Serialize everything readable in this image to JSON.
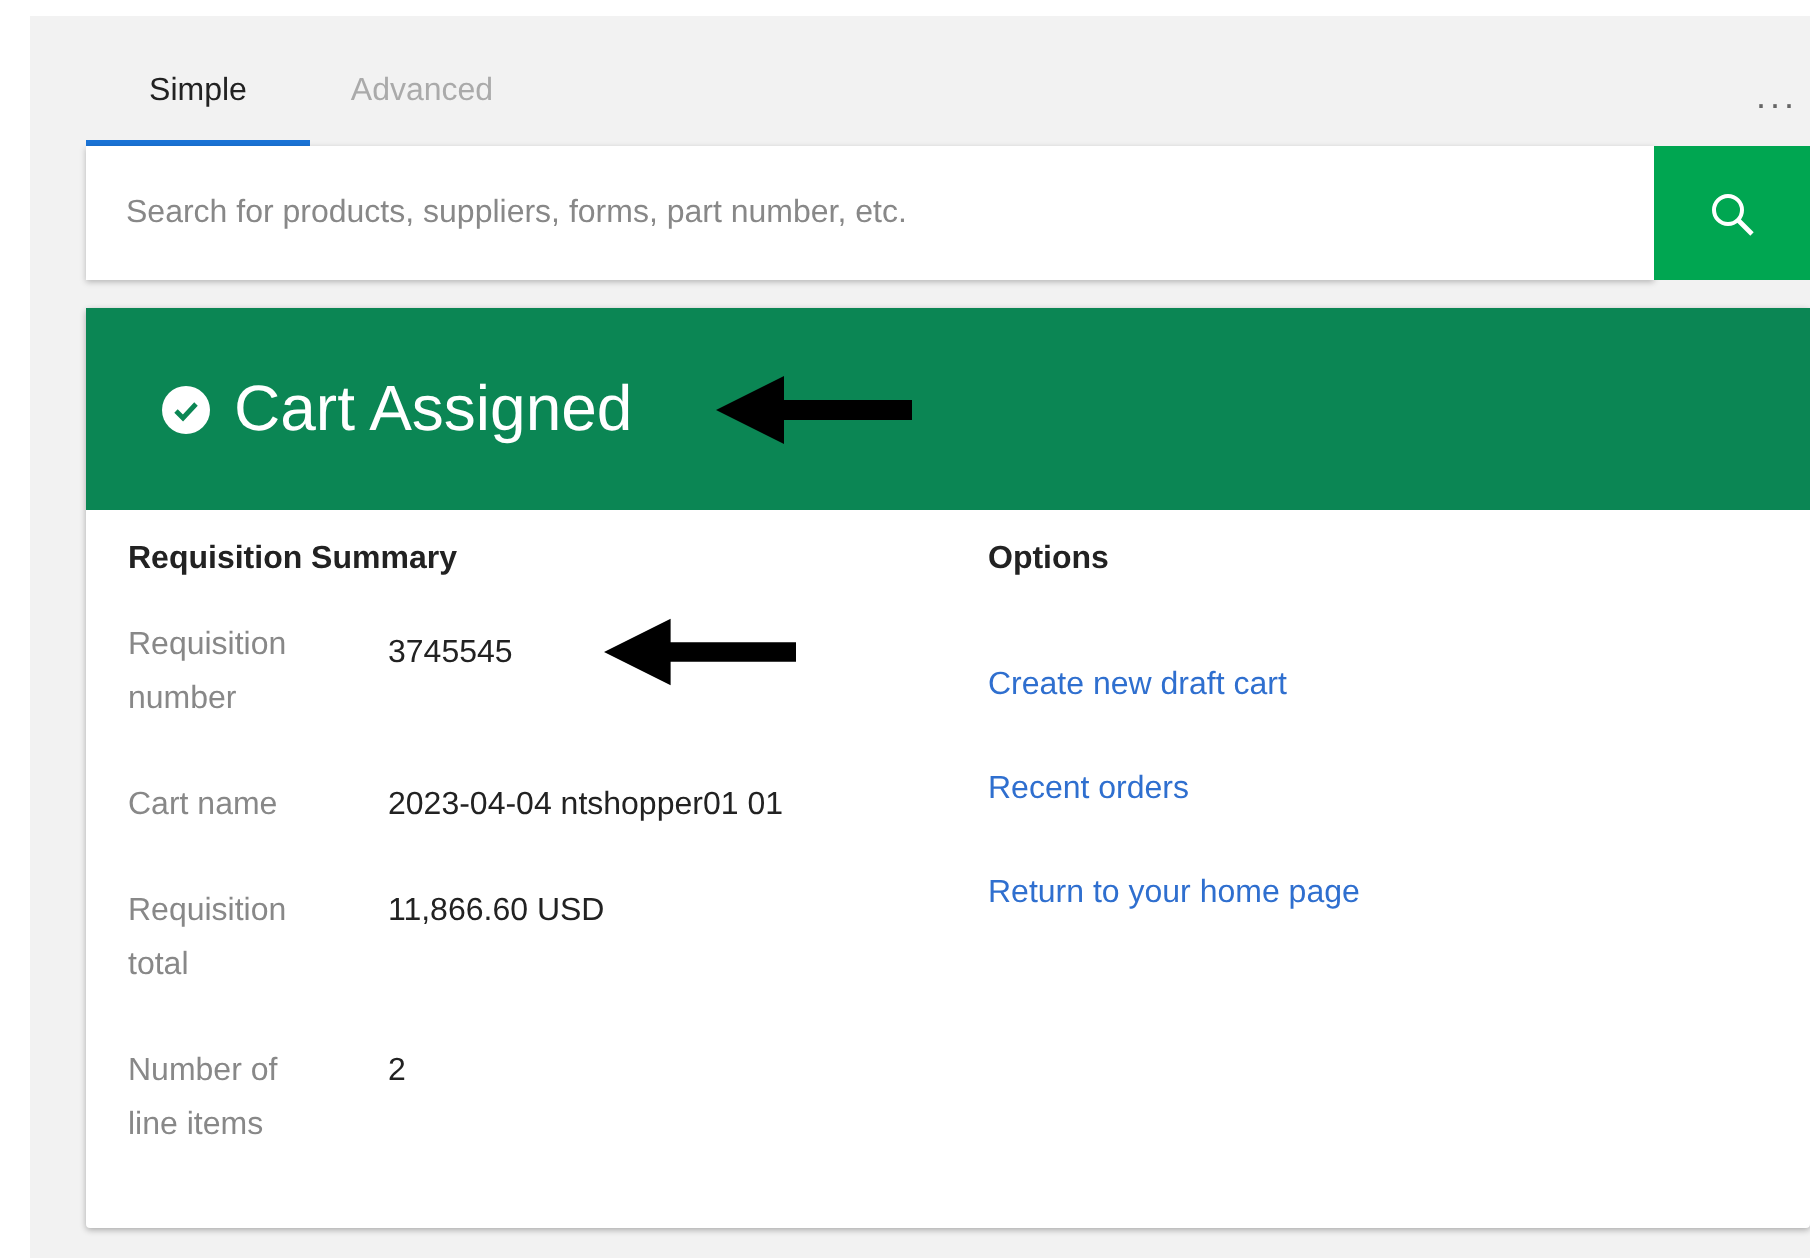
{
  "tabs": [
    {
      "label": "Simple",
      "selected": true
    },
    {
      "label": "Advanced",
      "selected": false
    }
  ],
  "more_menu": "...",
  "search": {
    "placeholder": "Search for products, suppliers, forms, part number, etc."
  },
  "status": {
    "title": "Cart Assigned"
  },
  "summary": {
    "heading": "Requisition Summary",
    "rows": [
      {
        "label": "Requisition number",
        "value": "3745545"
      },
      {
        "label": "Cart name",
        "value": "2023-04-04 ntshopper01 01"
      },
      {
        "label": "Requisition total",
        "value": "11,866.60 USD"
      },
      {
        "label": "Number of line items",
        "value": "2"
      }
    ]
  },
  "options": {
    "heading": "Options",
    "links": [
      "Create new draft cart",
      "Recent orders",
      "Return to your home page"
    ]
  }
}
